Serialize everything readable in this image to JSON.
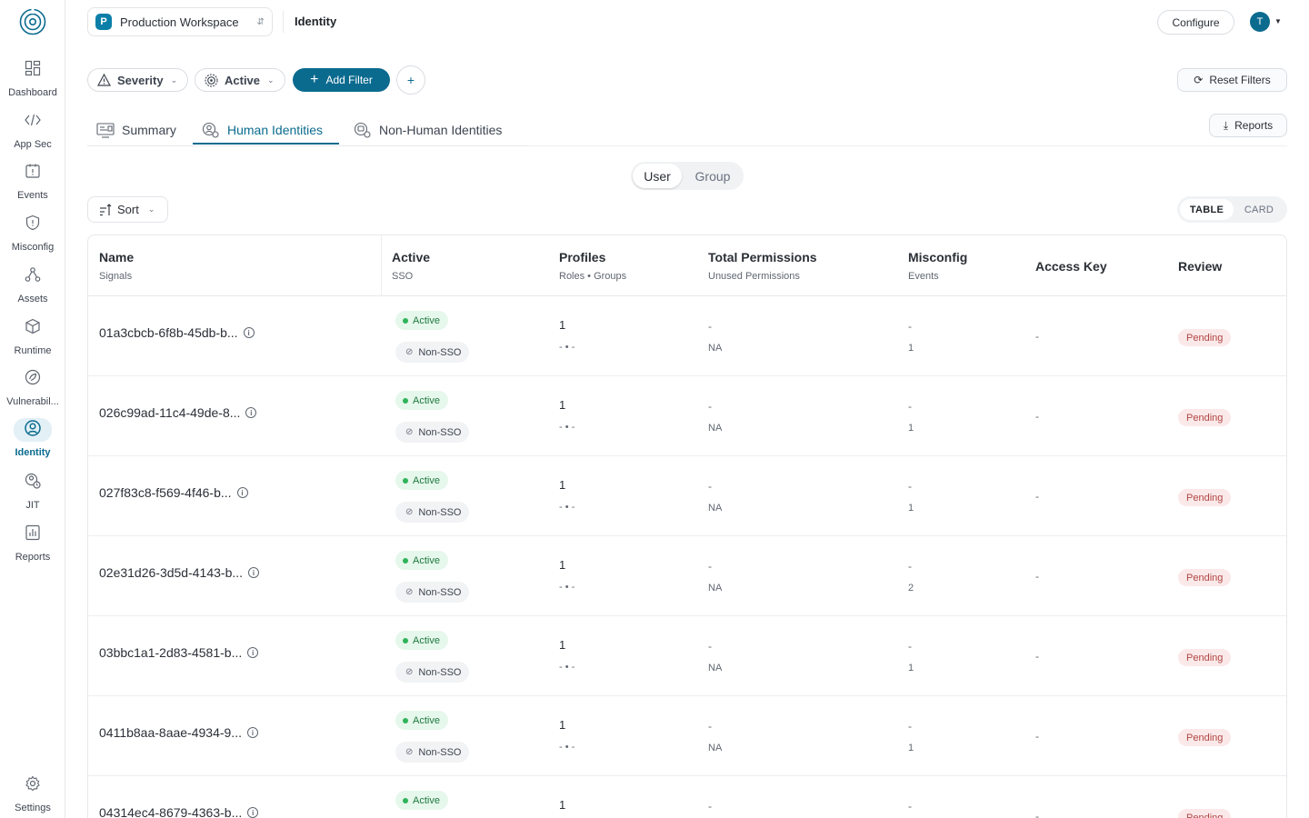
{
  "workspace": {
    "badge": "P",
    "name": "Production Workspace"
  },
  "header": {
    "title": "Identity",
    "configure_label": "Configure",
    "avatar_initial": "T"
  },
  "sidebar": {
    "items": [
      {
        "label": "Dashboard",
        "icon": "dashboard-icon"
      },
      {
        "label": "App Sec",
        "icon": "code-icon"
      },
      {
        "label": "Events",
        "icon": "events-icon"
      },
      {
        "label": "Misconfig",
        "icon": "shield-icon"
      },
      {
        "label": "Assets",
        "icon": "assets-icon"
      },
      {
        "label": "Runtime",
        "icon": "cube-icon"
      },
      {
        "label": "Vulnerabil...",
        "icon": "vulnerability-icon"
      },
      {
        "label": "Identity",
        "icon": "identity-icon",
        "active": true
      },
      {
        "label": "JIT",
        "icon": "jit-icon"
      },
      {
        "label": "Reports",
        "icon": "reports-icon"
      }
    ],
    "settings_label": "Settings"
  },
  "filters": {
    "severity_label": "Severity",
    "active_label": "Active",
    "add_filter_label": "Add Filter",
    "plus_label": "+",
    "reset_label": "Reset Filters"
  },
  "tabs": [
    {
      "label": "Summary"
    },
    {
      "label": "Human Identities",
      "active": true
    },
    {
      "label": "Non-Human Identities"
    }
  ],
  "reports_label": "Reports",
  "segment": {
    "options": [
      "User",
      "Group"
    ],
    "selected": "User"
  },
  "sort_label": "Sort",
  "view_toggle": {
    "options": [
      "TABLE",
      "CARD"
    ],
    "selected": "TABLE"
  },
  "table": {
    "columns": [
      {
        "title": "Name",
        "subtitle": "Signals"
      },
      {
        "title": "Active",
        "subtitle": "SSO"
      },
      {
        "title": "Profiles",
        "subtitle": "Roles • Groups"
      },
      {
        "title": "Total Permissions",
        "subtitle": "Unused Permissions"
      },
      {
        "title": "Misconfig",
        "subtitle": "Events"
      },
      {
        "title": "Access Key",
        "subtitle": ""
      },
      {
        "title": "Review",
        "subtitle": ""
      }
    ],
    "rows": [
      {
        "name": "01a3cbcb-6f8b-45db-b...",
        "active": "Active",
        "sso": "Non-SSO",
        "profiles": "1",
        "roles_groups": "- • -",
        "total_permissions": "-",
        "unused_permissions": "NA",
        "misconfig": "-",
        "events": "1",
        "access_key": "-",
        "review": "Pending"
      },
      {
        "name": "026c99ad-11c4-49de-8...",
        "active": "Active",
        "sso": "Non-SSO",
        "profiles": "1",
        "roles_groups": "- • -",
        "total_permissions": "-",
        "unused_permissions": "NA",
        "misconfig": "-",
        "events": "1",
        "access_key": "-",
        "review": "Pending"
      },
      {
        "name": "027f83c8-f569-4f46-b...",
        "active": "Active",
        "sso": "Non-SSO",
        "profiles": "1",
        "roles_groups": "- • -",
        "total_permissions": "-",
        "unused_permissions": "NA",
        "misconfig": "-",
        "events": "1",
        "access_key": "-",
        "review": "Pending"
      },
      {
        "name": "02e31d26-3d5d-4143-b...",
        "active": "Active",
        "sso": "Non-SSO",
        "profiles": "1",
        "roles_groups": "- • -",
        "total_permissions": "-",
        "unused_permissions": "NA",
        "misconfig": "-",
        "events": "2",
        "access_key": "-",
        "review": "Pending"
      },
      {
        "name": "03bbc1a1-2d83-4581-b...",
        "active": "Active",
        "sso": "Non-SSO",
        "profiles": "1",
        "roles_groups": "- • -",
        "total_permissions": "-",
        "unused_permissions": "NA",
        "misconfig": "-",
        "events": "1",
        "access_key": "-",
        "review": "Pending"
      },
      {
        "name": "0411b8aa-8aae-4934-9...",
        "active": "Active",
        "sso": "Non-SSO",
        "profiles": "1",
        "roles_groups": "- • -",
        "total_permissions": "-",
        "unused_permissions": "NA",
        "misconfig": "-",
        "events": "1",
        "access_key": "-",
        "review": "Pending"
      },
      {
        "name": "04314ec4-8679-4363-b...",
        "active": "Active",
        "sso": "",
        "profiles": "1",
        "roles_groups": "",
        "total_permissions": "-",
        "unused_permissions": "",
        "misconfig": "-",
        "events": "",
        "access_key": "-",
        "review": "Pending"
      }
    ]
  },
  "colors": {
    "accent": "#0b6b8f",
    "active_green": "#2fb35a",
    "pending_red": "#b24545"
  }
}
